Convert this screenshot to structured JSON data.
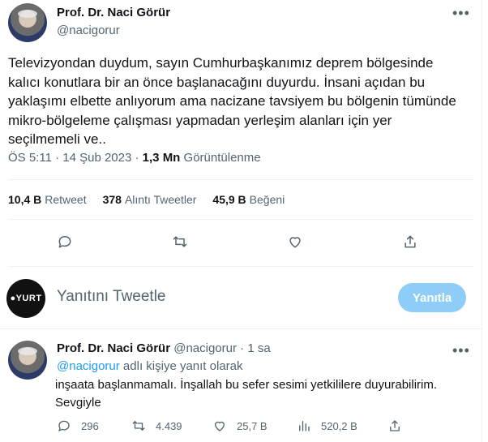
{
  "tweet": {
    "author_name": "Prof. Dr. Naci Görür",
    "author_handle": "@nacigorur",
    "text": "Televizyondan duydum, sayın Cumhurbaşkanımız deprem bölgesinde kalıcı konutlara bir an önce başlanacağını duyurdu. İnsani açıdan bu yaklaşımı elbette anlıyorum ama nacizane tavsiyem bu bölgenin tümünde mikro-bölgeleme çalışması yapmadan yerleşim alanları için yer seçilmemeli ve..",
    "time": "ÖS 5:11 · 14 Şub 2023 ·",
    "views_count": "1,3 Mn",
    "views_label": "Görüntülenme",
    "more_icon": "•••"
  },
  "stats": {
    "retweets_count": "10,4 B",
    "retweets_label": "Retweet",
    "quotes_count": "378",
    "quotes_label": "Alıntı Tweetler",
    "likes_count": "45,9 B",
    "likes_label": "Beğeni"
  },
  "actions": [
    "reply-icon",
    "retweet-icon",
    "like-icon",
    "share-icon"
  ],
  "composer": {
    "logo_text": "●YURT",
    "placeholder": "Yanıtını Tweetle",
    "button_label": "Yanıtla",
    "button_color": "#8ecdf8"
  },
  "reply": {
    "author_name": "Prof. Dr. Naci Görür",
    "author_handle": "@nacigorur",
    "time": "· 1 sa",
    "replying_to_handle": "@nacigorur",
    "replying_to_suffix": " adlı kişiye yanıt olarak",
    "text_line1": "inşaata başlanmamalı. İnşallah bu sefer sesimi yetkililere duyurabilirim.",
    "text_line2": "Sevgiyle",
    "replies": "296",
    "retweets": "4.439",
    "likes": "25,7 B",
    "views": "520,2 B",
    "more_icon": "•••"
  },
  "colors": {
    "accent": "#1d9bf0",
    "muted": "#536471",
    "divider": "#eff3f4"
  }
}
